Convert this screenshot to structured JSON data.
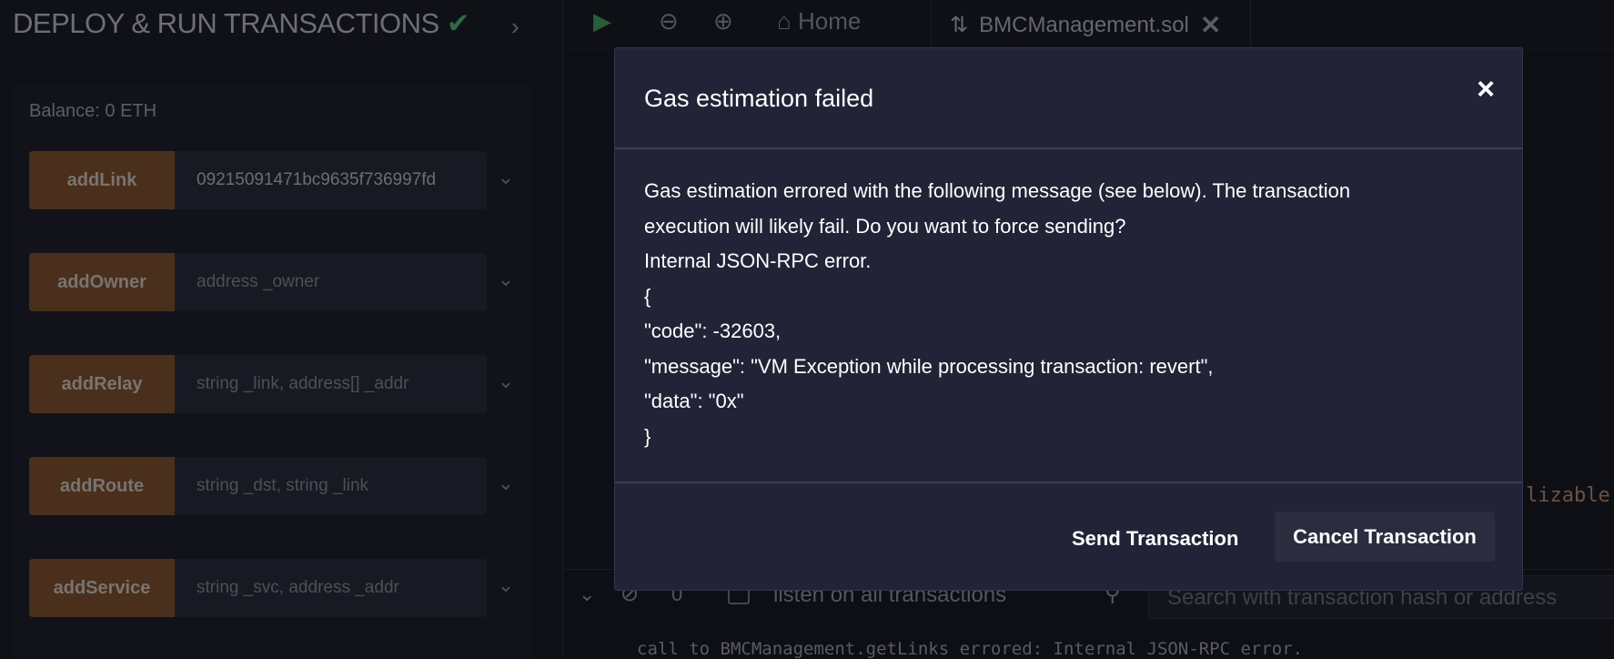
{
  "panel": {
    "title": "DEPLOY & RUN TRANSACTIONS",
    "balance": "Balance: 0 ETH",
    "functions": [
      {
        "name": "addLink",
        "value": "09215091471bc9635f736997fd",
        "placeholder": ""
      },
      {
        "name": "addOwner",
        "value": "",
        "placeholder": "address _owner"
      },
      {
        "name": "addRelay",
        "value": "",
        "placeholder": "string _link, address[] _addr"
      },
      {
        "name": "addRoute",
        "value": "",
        "placeholder": "string _dst, string _link"
      },
      {
        "name": "addService",
        "value": "",
        "placeholder": "string _svc, address _addr"
      }
    ]
  },
  "topbar": {
    "home": "Home",
    "tab": "BMCManagement.sol"
  },
  "editor": {
    "fragment": "lizable"
  },
  "terminal": {
    "count": "0",
    "listen": "listen on all transactions",
    "search_placeholder": "Search with transaction hash or address",
    "log": "call to BMCManagement.getLinks errored: Internal JSON-RPC error."
  },
  "modal": {
    "title": "Gas estimation failed",
    "lines": [
      "Gas estimation errored with the following message (see below). The transaction",
      "execution will likely fail. Do you want to force sending?",
      "Internal JSON-RPC error.",
      "{",
      "\"code\": -32603,",
      "\"message\": \"VM Exception while processing transaction: revert\",",
      "\"data\": \"0x\"",
      "}"
    ],
    "send": "Send Transaction",
    "cancel": "Cancel Transaction"
  }
}
